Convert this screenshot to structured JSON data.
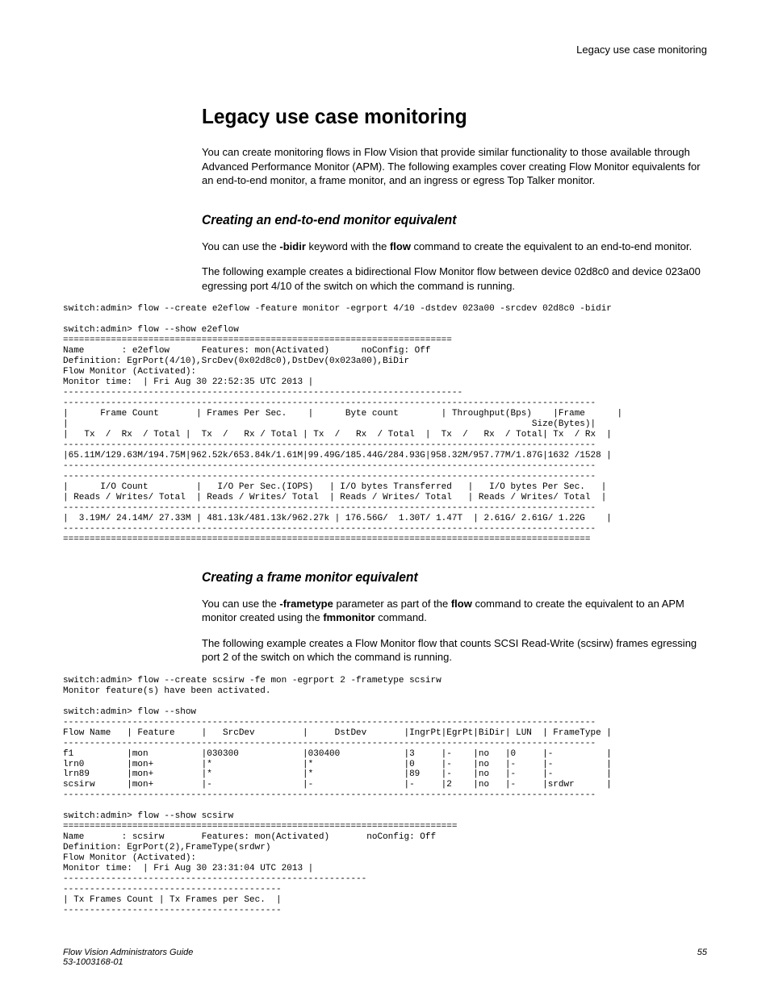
{
  "running_head": "Legacy use case monitoring",
  "section_title": "Legacy use case monitoring",
  "intro_para": "You can create monitoring flows in Flow Vision that provide similar functionality to those available through Advanced Performance Monitor (APM). The following examples cover creating Flow Monitor equivalents for an end-to-end monitor, a frame monitor, and an ingress or egress Top Talker monitor.",
  "sub1_title": "Creating an end-to-end monitor equivalent",
  "sub1_p1_pre": "You can use the ",
  "sub1_p1_b1": "-bidir",
  "sub1_p1_mid1": " keyword with the ",
  "sub1_p1_b2": "flow",
  "sub1_p1_tail": " command to create the equivalent to an end-to-end monitor.",
  "sub1_p2": "The following example creates a bidirectional Flow Monitor flow between device 02d8c0 and device 023a00 egressing port 4/10 of the switch on which the command is running.",
  "term1": "switch:admin> flow --create e2eflow -feature monitor -egrport 4/10 -dstdev 023a00 -srcdev 02d8c0 -bidir\n\nswitch:admin> flow --show e2eflow\n=========================================================================\nName       : e2eflow      Features: mon(Activated)      noConfig: Off\nDefinition: EgrPort(4/10),SrcDev(0x02d8c0),DstDev(0x023a00),BiDir\nFlow Monitor (Activated):\nMonitor time:  | Fri Aug 30 22:52:35 UTC 2013 |\n---------------------------------------------------------------------------\n----------------------------------------------------------------------------------------------------\n|      Frame Count       | Frames Per Sec.    |      Byte count        | Throughput(Bps)    |Frame      |\n|                                                                                       Size(Bytes)|\n|   Tx  /  Rx  / Total |  Tx  /   Rx / Total | Tx  /   Rx  / Total  |  Tx  /   Rx  / Total| Tx  / Rx  |\n----------------------------------------------------------------------------------------------------\n|65.11M/129.63M/194.75M|962.52k/653.84k/1.61M|99.49G/185.44G/284.93G|958.32M/957.77M/1.87G|1632 /1528 |\n----------------------------------------------------------------------------------------------------\n----------------------------------------------------------------------------------------------------\n|      I/O Count         |   I/O Per Sec.(IOPS)   | I/O bytes Transferred   |   I/O bytes Per Sec.   |\n| Reads / Writes/ Total  | Reads / Writes/ Total  | Reads / Writes/ Total   | Reads / Writes/ Total  |\n----------------------------------------------------------------------------------------------------\n|  3.19M/ 24.14M/ 27.33M | 481.13k/481.13k/962.27k | 176.56G/  1.30T/ 1.47T  | 2.61G/ 2.61G/ 1.22G    |\n----------------------------------------------------------------------------------------------------\n===================================================================================================",
  "sub2_title": "Creating a frame monitor equivalent",
  "sub2_p1_pre": "You can use the ",
  "sub2_p1_b1": "-frametype",
  "sub2_p1_mid1": " parameter as part of the ",
  "sub2_p1_b2": "flow",
  "sub2_p1_mid2": " command to create the equivalent to an APM monitor created using the ",
  "sub2_p1_b3": "fmmonitor",
  "sub2_p1_tail": " command.",
  "sub2_p2": "The following example creates a Flow Monitor flow that counts SCSI Read-Write (scsirw) frames egressing port 2 of the switch on which the command is running.",
  "term2": "switch:admin> flow --create scsirw -fe mon -egrport 2 -frametype scsirw\nMonitor feature(s) have been activated.\n\nswitch:admin> flow --show\n----------------------------------------------------------------------------------------------------\nFlow Name   | Feature     |   SrcDev         |     DstDev       |IngrPt|EgrPt|BiDir| LUN  | FrameType |\n----------------------------------------------------------------------------------------------------\nf1          |mon          |030300            |030400            |3     |-    |no   |0     |-          |\nlrn0        |mon+         |*                 |*                 |0     |-    |no   |-     |-          |\nlrn89       |mon+         |*                 |*                 |89    |-    |no   |-     |-          |\nscsirw      |mon+         |-                 |-                 |-     |2    |no   |-     |srdwr      |\n----------------------------------------------------------------------------------------------------\n\nswitch:admin> flow --show scsirw\n==========================================================================\nName       : scsirw       Features: mon(Activated)       noConfig: Off\nDefinition: EgrPort(2),FrameType(srdwr)\nFlow Monitor (Activated):\nMonitor time:  | Fri Aug 30 23:31:04 UTC 2013 |\n---------------------------------------------------------\n-----------------------------------------\n| Tx Frames Count | Tx Frames per Sec.  |\n-----------------------------------------",
  "footer_left": "Flow Vision Administrators Guide",
  "footer_doc": "53-1003168-01",
  "footer_page": "55"
}
